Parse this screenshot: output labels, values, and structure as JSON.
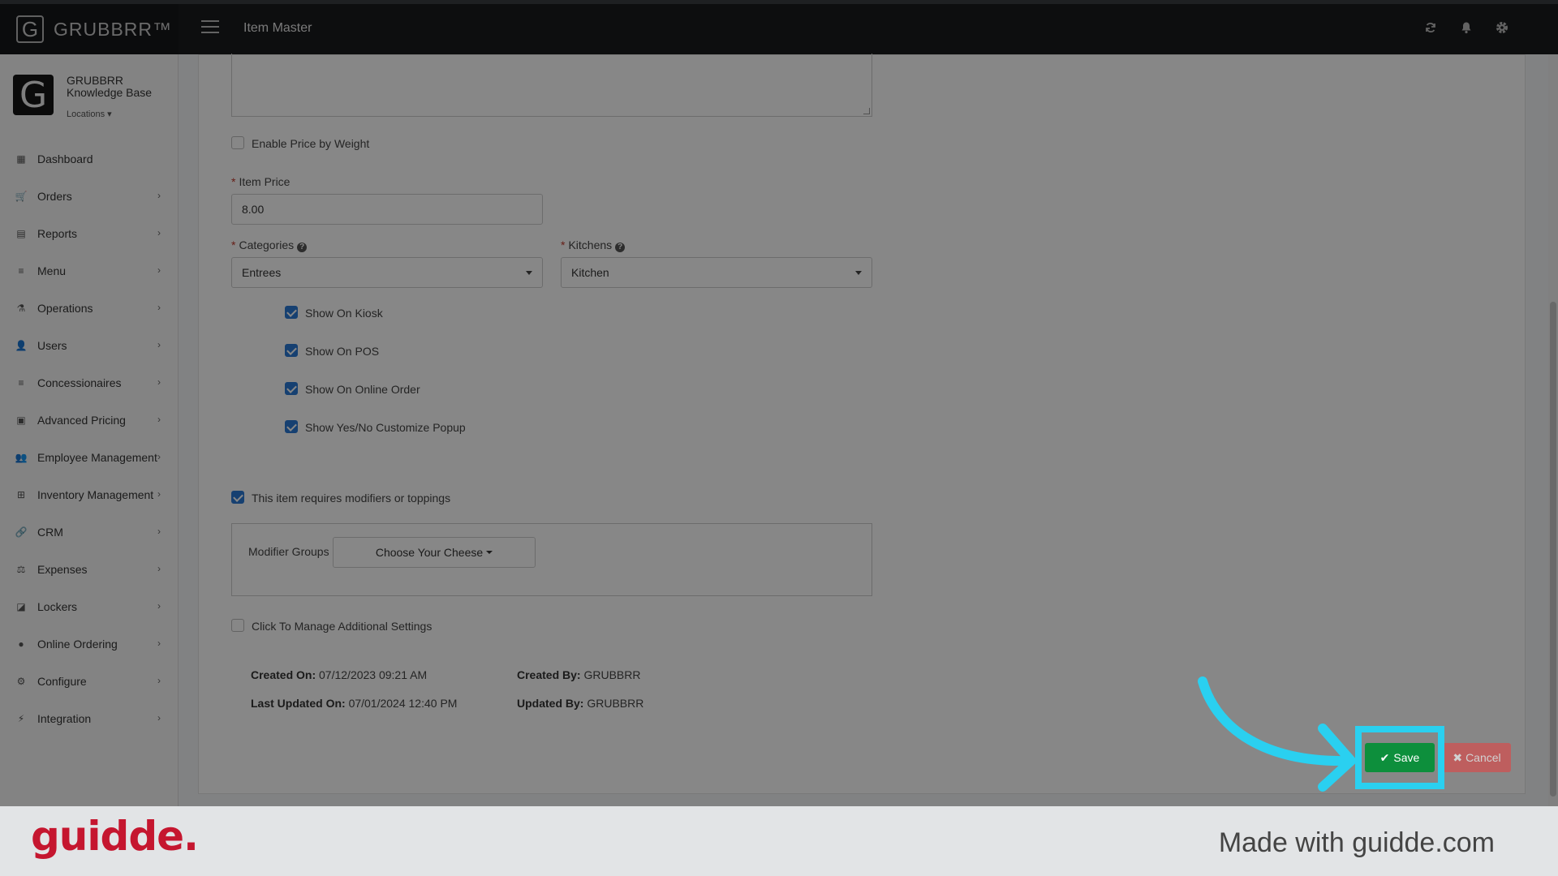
{
  "brand": {
    "name": "GRUBBRR™",
    "logo_letter": "G"
  },
  "header": {
    "title": "Item Master"
  },
  "org": {
    "line1": "GRUBBRR",
    "line2": "Knowledge Base",
    "locations_label": "Locations"
  },
  "sidebar": {
    "items": [
      {
        "label": "Dashboard",
        "icon": "dashboard-icon",
        "chevron": false
      },
      {
        "label": "Orders",
        "icon": "cart-icon",
        "chevron": true
      },
      {
        "label": "Reports",
        "icon": "report-icon",
        "chevron": true
      },
      {
        "label": "Menu",
        "icon": "menu-list-icon",
        "chevron": true
      },
      {
        "label": "Operations",
        "icon": "flask-icon",
        "chevron": true
      },
      {
        "label": "Users",
        "icon": "user-plus-icon",
        "chevron": true
      },
      {
        "label": "Concessionaires",
        "icon": "list-icon",
        "chevron": true
      },
      {
        "label": "Advanced Pricing",
        "icon": "money-icon",
        "chevron": true
      },
      {
        "label": "Employee Management",
        "icon": "users-icon",
        "chevron": true
      },
      {
        "label": "Inventory Management",
        "icon": "sitemap-icon",
        "chevron": true
      },
      {
        "label": "CRM",
        "icon": "link-icon",
        "chevron": true
      },
      {
        "label": "Expenses",
        "icon": "scale-icon",
        "chevron": true
      },
      {
        "label": "Lockers",
        "icon": "locker-icon",
        "chevron": true
      },
      {
        "label": "Online Ordering",
        "icon": "globe-icon",
        "chevron": true
      },
      {
        "label": "Configure",
        "icon": "gear-icon",
        "chevron": true
      },
      {
        "label": "Integration",
        "icon": "plug-icon",
        "chevron": true
      }
    ]
  },
  "form": {
    "price_by_weight": {
      "label": "Enable Price by Weight",
      "checked": false
    },
    "item_price": {
      "label": "Item Price",
      "value": "8.00"
    },
    "categories": {
      "label": "Categories",
      "value": "Entrees"
    },
    "kitchens": {
      "label": "Kitchens",
      "value": "Kitchen"
    },
    "show_options": [
      {
        "label": "Show On Kiosk",
        "checked": true
      },
      {
        "label": "Show On POS",
        "checked": true
      },
      {
        "label": "Show On Online Order",
        "checked": true
      },
      {
        "label": "Show Yes/No Customize Popup",
        "checked": true
      }
    ],
    "requires_modifiers": {
      "label": "This item requires modifiers or toppings",
      "checked": true
    },
    "modifier_groups": {
      "label": "Modifier Groups",
      "value": "Choose Your Cheese"
    },
    "additional_settings": {
      "label": "Click To Manage Additional Settings",
      "checked": false
    }
  },
  "meta": {
    "created_on_label": "Created On:",
    "created_on": "07/12/2023 09:21 AM",
    "updated_on_label": "Last Updated On:",
    "updated_on": "07/01/2024 12:40 PM",
    "created_by_label": "Created By:",
    "created_by": "GRUBBRR",
    "updated_by_label": "Updated By:",
    "updated_by": "GRUBBRR"
  },
  "actions": {
    "save_label": "Save",
    "cancel_label": "Cancel"
  },
  "footer": {
    "logo_text": "guidde.",
    "made_with": "Made with guidde.com"
  },
  "colors": {
    "highlight": "#2ad0f0",
    "save": "#0d8f3c",
    "cancel": "#e04545",
    "guidde_red": "#c5162f"
  }
}
